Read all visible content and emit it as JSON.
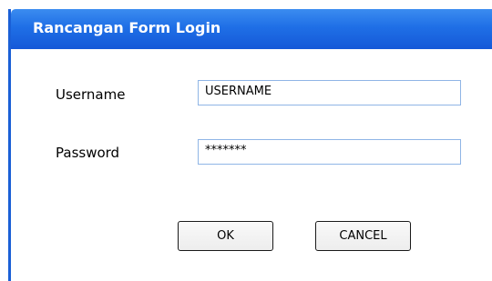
{
  "window": {
    "title": "Rancangan Form Login"
  },
  "form": {
    "username_label": "Username",
    "username_value": "USERNAME",
    "password_label": "Password",
    "password_value": "*******"
  },
  "buttons": {
    "ok_label": "OK",
    "cancel_label": "CANCEL"
  },
  "colors": {
    "titlebar": "#1f6fe6",
    "window_border": "#1a5fd6",
    "field_border": "#8fb5e6"
  }
}
